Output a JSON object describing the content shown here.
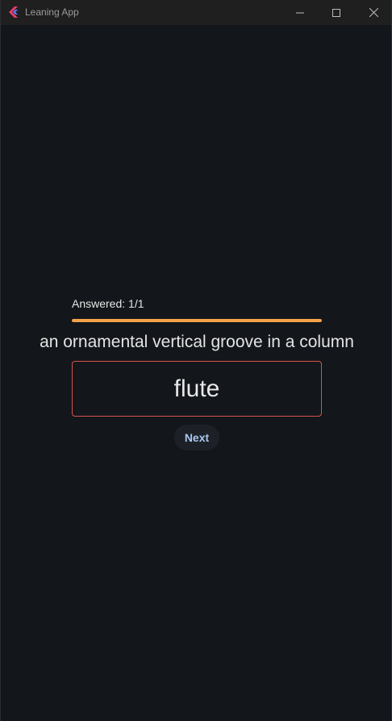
{
  "window": {
    "title": "Leaning App",
    "controls": {
      "minimize_icon": "minimize-icon",
      "maximize_icon": "maximize-icon",
      "close_icon": "close-icon"
    }
  },
  "quiz": {
    "progress_label": "Answered: 1/1",
    "progress_fraction": 1.0,
    "question": "an ornamental vertical groove in a column",
    "answer": "flute",
    "next_label": "Next"
  },
  "colors": {
    "background": "#13161b",
    "accent_progress": "#f4a24a",
    "answer_border_error": "#d8534d",
    "next_text": "#a9c8f0"
  }
}
